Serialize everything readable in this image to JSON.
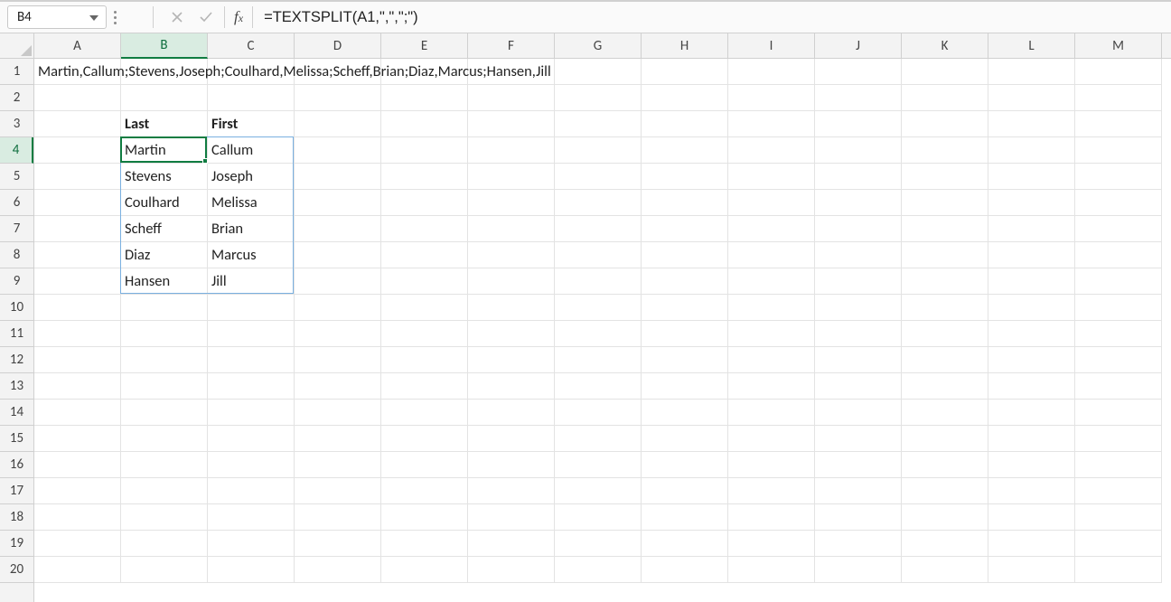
{
  "formula_bar": {
    "cell_reference": "B4",
    "formula": "=TEXTSPLIT(A1,\",\",\";\")"
  },
  "columns": [
    "A",
    "B",
    "C",
    "D",
    "E",
    "F",
    "G",
    "H",
    "I",
    "J",
    "K",
    "L",
    "M"
  ],
  "rows": [
    "1",
    "2",
    "3",
    "4",
    "5",
    "6",
    "7",
    "8",
    "9",
    "10",
    "11",
    "12",
    "13",
    "14",
    "15",
    "16",
    "17",
    "18",
    "19",
    "20"
  ],
  "active_column_index": 1,
  "active_row_index": 3,
  "cells": {
    "A1": "Martin,Callum;Stevens,Joseph;Coulhard,Melissa;Scheff,Brian;Diaz,Marcus;Hansen,Jill",
    "B3": "Last",
    "C3": "First",
    "B4": "Martin",
    "C4": "Callum",
    "B5": "Stevens",
    "C5": "Joseph",
    "B6": "Coulhard",
    "C6": "Melissa",
    "B7": "Scheff",
    "C7": "Brian",
    "B8": "Diaz",
    "C8": "Marcus",
    "B9": "Hansen",
    "C9": "Jill"
  },
  "bold_cells": [
    "B3",
    "C3"
  ],
  "active_cell": "B4",
  "spill_range": {
    "start": "B4",
    "end": "C9"
  }
}
